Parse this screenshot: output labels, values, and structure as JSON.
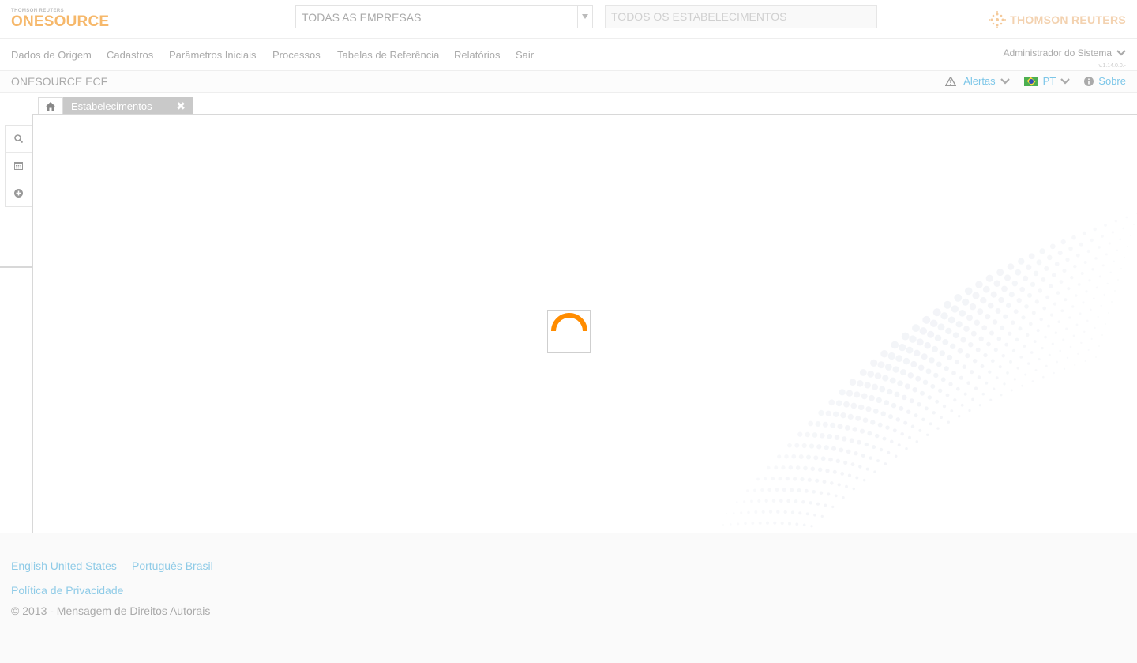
{
  "header": {
    "logo_small": "THOMSON REUTERS",
    "logo_main": "ONESOURCE",
    "company_select": "TODAS AS EMPRESAS",
    "establishment_placeholder": "TODOS OS ESTABELECIMENTOS",
    "brand": "THOMSON REUTERS"
  },
  "nav": {
    "items": [
      "Dados de Origem",
      "Cadastros",
      "Parâmetros Iniciais",
      "Processos",
      "Tabelas de Referência",
      "Relatórios",
      "Sair"
    ],
    "user": "Administrador do Sistema",
    "version": "v.1.14.0.0.-"
  },
  "appbar": {
    "title": "ONESOURCE ECF",
    "alerts": "Alertas",
    "language": "PT",
    "about": "Sobre"
  },
  "tabs": {
    "active": "Estabelecimentos",
    "close_glyph": "✖"
  },
  "footer": {
    "lang_en": "English United States",
    "lang_pt": "Português Brasil",
    "privacy": "Política de Privacidade",
    "copyright": "© 2013 - Mensagem de Direitos Autorais"
  },
  "colors": {
    "accent_orange": "#ff8c00",
    "link_blue": "#7cc6e8",
    "logo_orange": "#f6b86b"
  },
  "icons": [
    "home-icon",
    "close-icon",
    "search-icon",
    "calendar-icon",
    "add-circle-icon",
    "warning-icon",
    "chevron-down-icon",
    "info-icon",
    "brazil-flag-icon",
    "thomson-reuters-logo-icon",
    "loading-spinner-icon"
  ]
}
